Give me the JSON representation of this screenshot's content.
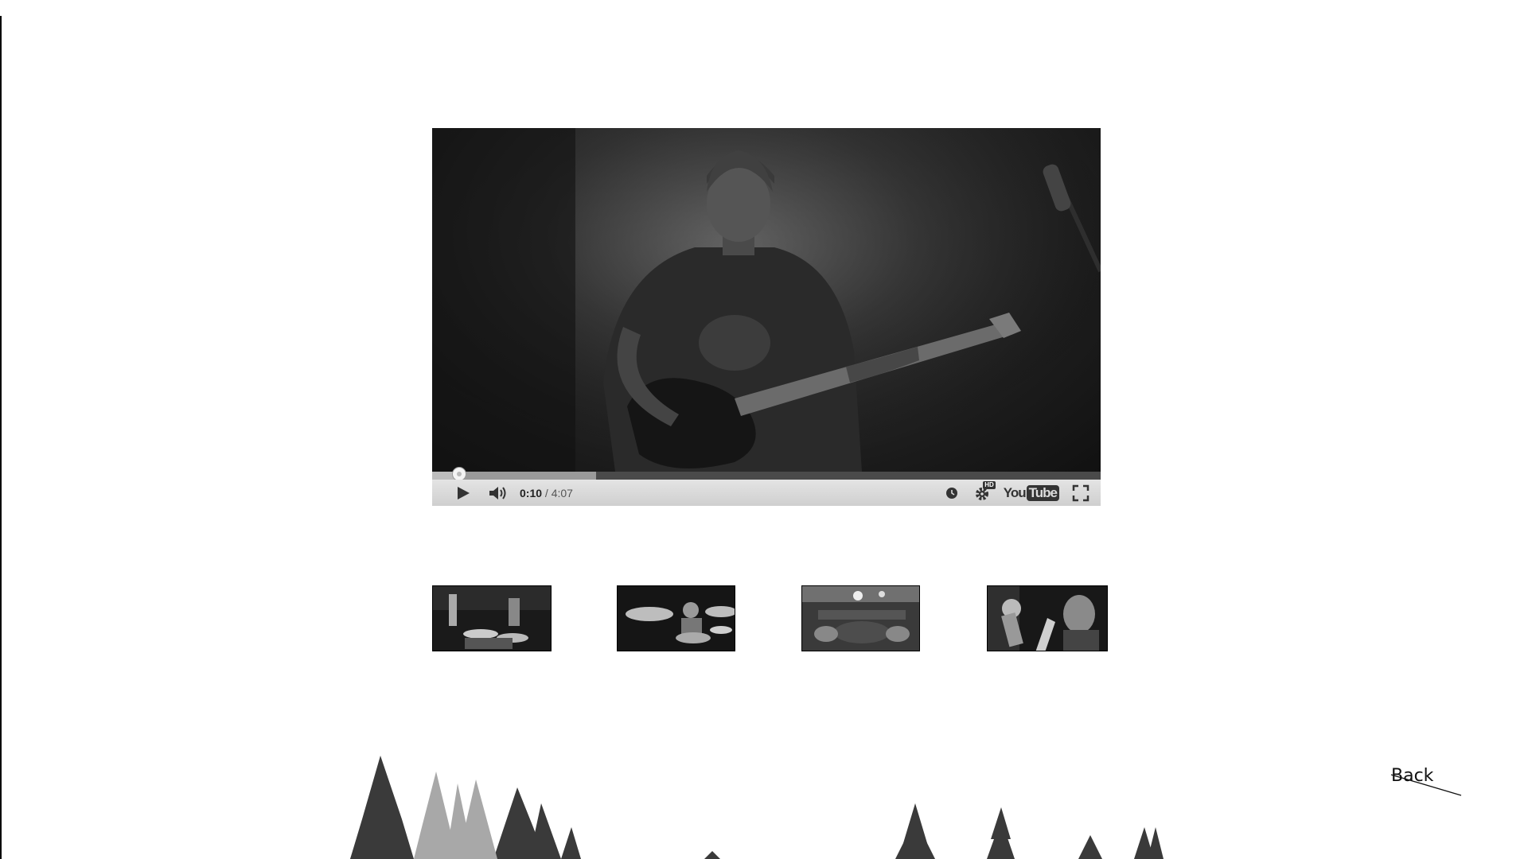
{
  "player": {
    "current_time": "0:10",
    "separator": "/",
    "total_time": "4:07",
    "progress_played": 0.04,
    "progress_buffered": 0.245,
    "hd_badge": "HD",
    "brand_you": "You",
    "brand_tube": "Tube",
    "icons": [
      "play-icon",
      "volume-icon",
      "watch-later-icon",
      "settings-gear-icon",
      "youtube-logo",
      "fullscreen-icon"
    ]
  },
  "thumbnails": [
    {
      "name": "thumbnail-1"
    },
    {
      "name": "thumbnail-2"
    },
    {
      "name": "thumbnail-3"
    },
    {
      "name": "thumbnail-4"
    }
  ],
  "nav": {
    "back_label": "Back"
  },
  "colors": {
    "background": "#ffffff",
    "controls": "#d8d8d8",
    "video": "#1b1b1b"
  }
}
